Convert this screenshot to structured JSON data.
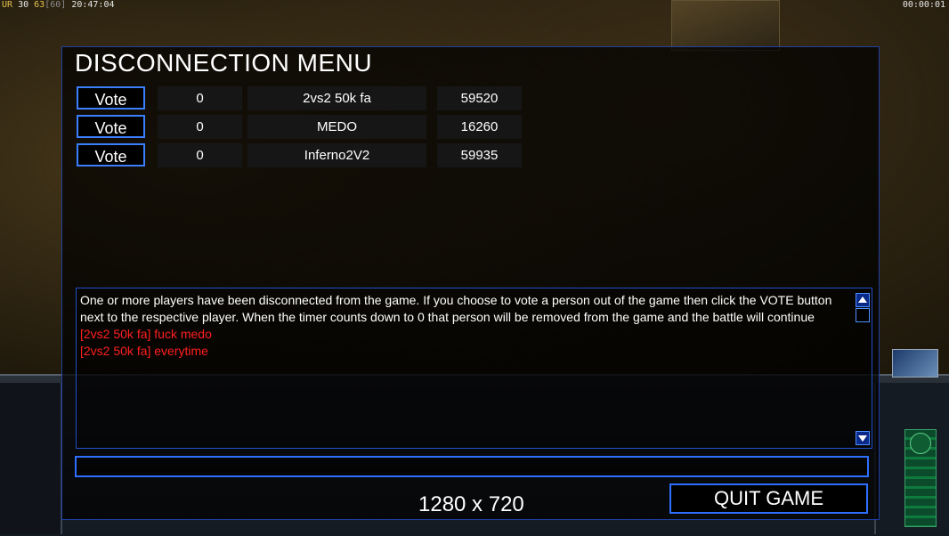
{
  "hud": {
    "ur_label": "UR",
    "val_a": "30",
    "val_b": "63",
    "val_c": "[60]",
    "clock": "20:47:04",
    "game_timer": "00:00:01"
  },
  "dialog": {
    "title": "DISCONNECTION MENU",
    "rows": [
      {
        "vote_label": "Vote",
        "count": "0",
        "player": "2vs2 50k fa",
        "timer": "59520"
      },
      {
        "vote_label": "Vote",
        "count": "0",
        "player": "MEDO",
        "timer": "16260"
      },
      {
        "vote_label": "Vote",
        "count": "0",
        "player": "Inferno2V2",
        "timer": "59935"
      }
    ],
    "chat": {
      "info": "One or more players have been disconnected from the game. If you choose to vote a person out of the game then click the VOTE button next to the respective player. When the timer counts down to 0 that person will be removed from the game and the battle will continue",
      "messages": [
        "[2vs2 50k fa] fuck medo",
        "[2vs2 50k fa] everytime"
      ]
    },
    "quit_label": "QUIT GAME",
    "resolution": "1280 x 720"
  },
  "colors": {
    "accent_border": "#2f6fff",
    "chat_message": "#ff1f1f",
    "hud_yellow": "#e3c14b"
  }
}
